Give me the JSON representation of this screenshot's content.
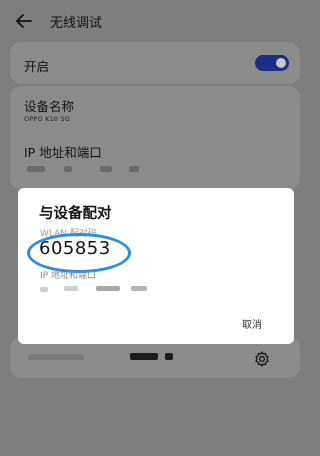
{
  "header": {
    "title": "无线调试",
    "back_icon": "back-arrow-icon"
  },
  "settings": {
    "enable_label": "开启",
    "enable_state": true,
    "device_name_label": "设备名称",
    "device_name_value": "OPPO K10 5G",
    "ip_port_label": "IP 地址和端口"
  },
  "dialog": {
    "title": "与设备配对",
    "wlan_code_label": "WLAN 配对码",
    "pairing_code": "605853",
    "ip_port_label": "IP 地址和端口",
    "cancel_label": "取消"
  },
  "colors": {
    "accent": "#1a2f88",
    "highlight": "#2a8fe0"
  },
  "icons": {
    "settings": "gear-icon"
  }
}
